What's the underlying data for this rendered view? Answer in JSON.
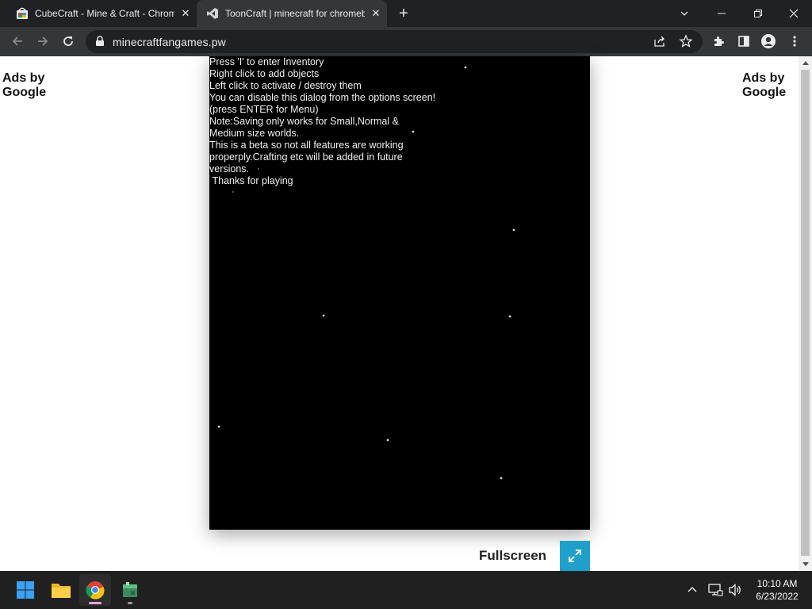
{
  "browser": {
    "tabs": [
      {
        "title": "CubeCraft - Mine & Craft - Chrome Web Store",
        "active": false
      },
      {
        "title": "ToonCraft | minecraft for chromebook",
        "active": true
      }
    ],
    "address": "minecraftfangames.pw"
  },
  "page": {
    "ads_left": "Ads by\nGoogle",
    "ads_right": "Ads by\nGoogle",
    "game_text": [
      "Press 'I' to enter Inventory",
      "Right click to add objects",
      "Left click to activate / destroy them",
      "You can disable this dialog from the options screen!",
      "(press ENTER for Menu)",
      "Note:Saving only works for Small,Normal &",
      "Medium size worlds.",
      "This is a beta so not all features are working",
      "properply.Crafting etc will be added in future",
      "versions.",
      " Thanks for playing"
    ],
    "fullscreen_label": "Fullscreen"
  },
  "taskbar": {
    "time": "10:10 AM",
    "date": "6/23/2022"
  },
  "colors": {
    "fullscreen_button": "#1fa0cc",
    "game_background": "#000000"
  }
}
